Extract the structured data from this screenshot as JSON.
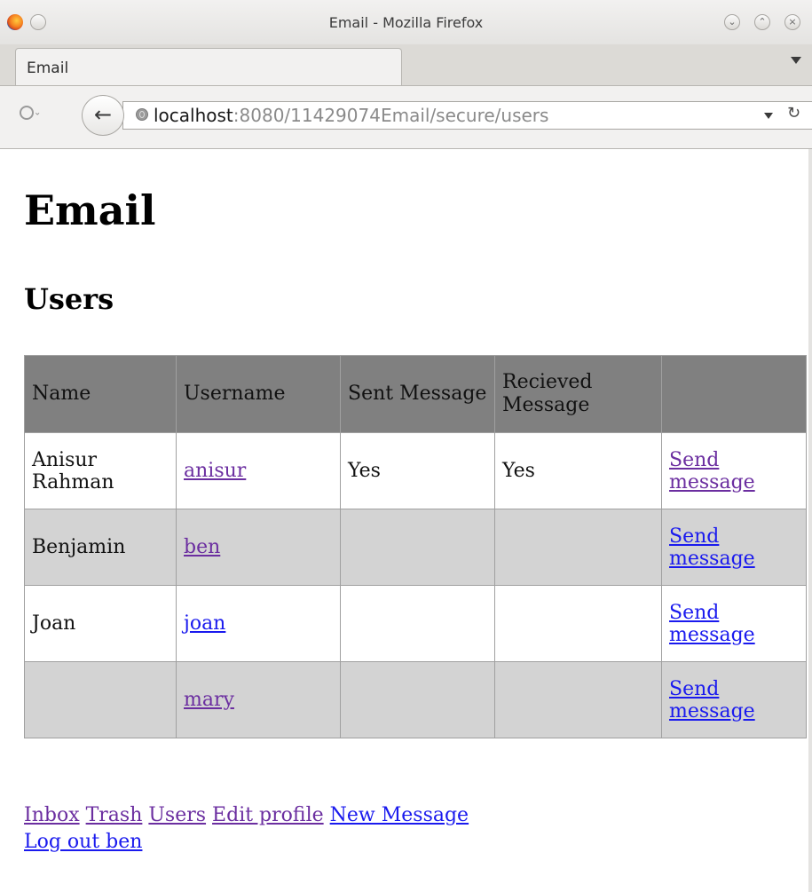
{
  "window": {
    "title": "Email - Mozilla Firefox"
  },
  "tabs": [
    {
      "label": "Email",
      "active": true
    }
  ],
  "navbar": {
    "url_host": "localhost",
    "url_rest": ":8080/11429074Email/secure/users"
  },
  "page": {
    "heading": "Email",
    "subheading": "Users"
  },
  "table": {
    "headers": [
      "Name",
      "Username",
      "Sent Message",
      "Recieved Message",
      ""
    ],
    "rows": [
      {
        "name": "Anisur Rahman",
        "username": "anisur",
        "sent": "Yes",
        "received": "Yes",
        "action": "Send message"
      },
      {
        "name": "Benjamin",
        "username": "ben",
        "sent": "",
        "received": "",
        "action": "Send message"
      },
      {
        "name": "Joan",
        "username": "joan",
        "sent": "",
        "received": "",
        "action": "Send message"
      },
      {
        "name": "",
        "username": "mary",
        "sent": "",
        "received": "",
        "action": "Send message"
      }
    ]
  },
  "footer": {
    "links": [
      "Inbox",
      "Trash",
      "Users",
      "Edit profile",
      "New Message",
      "Log out ben"
    ]
  },
  "colors": {
    "header_bg": "#808080",
    "alt_row_bg": "#d3d3d3",
    "link": "#1a1aee",
    "visited_link": "#6b2ea0"
  }
}
